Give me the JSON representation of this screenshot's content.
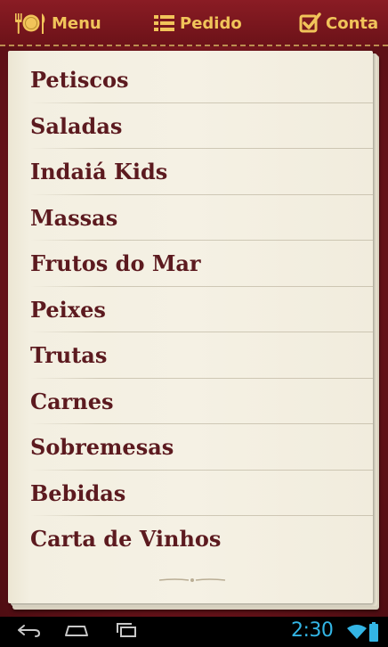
{
  "topbar": {
    "tabs": [
      {
        "label": "Menu",
        "icon": "fork-plate-knife-icon"
      },
      {
        "label": "Pedido",
        "icon": "list-icon"
      },
      {
        "label": "Conta",
        "icon": "checkbox-icon"
      }
    ],
    "accent_color": "#f1c45a"
  },
  "menu": {
    "categories": [
      {
        "label": "Petiscos"
      },
      {
        "label": "Saladas"
      },
      {
        "label": "Indaiá Kids"
      },
      {
        "label": "Massas"
      },
      {
        "label": "Frutos do Mar"
      },
      {
        "label": "Peixes"
      },
      {
        "label": "Trutas"
      },
      {
        "label": "Carnes"
      },
      {
        "label": "Sobremesas"
      },
      {
        "label": "Bebidas"
      },
      {
        "label": "Carta de Vinhos"
      }
    ],
    "text_color": "#5c1a1f"
  },
  "system_bar": {
    "clock": "2:30",
    "clock_color": "#33b5e5",
    "icons": [
      "back-icon",
      "home-icon",
      "recent-apps-icon",
      "wifi-icon",
      "battery-icon"
    ]
  }
}
